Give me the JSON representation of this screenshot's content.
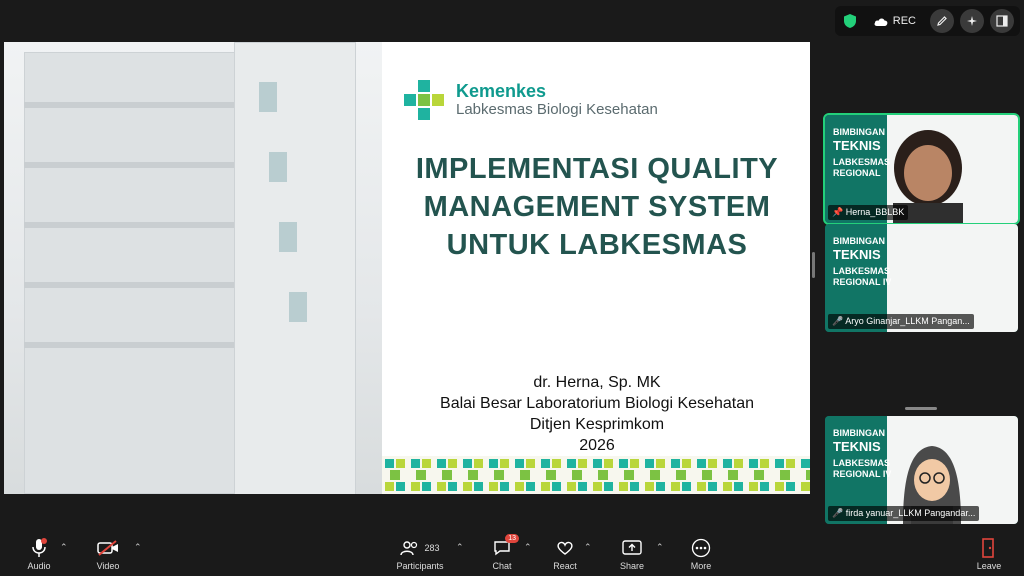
{
  "top": {
    "rec_label": "REC"
  },
  "slide": {
    "logo_name": "Kemenkes",
    "logo_sub": "Labkesmas Biologi Kesehatan",
    "title_lines": [
      "IMPLEMENTASI QUALITY",
      "MANAGEMENT SYSTEM",
      "UNTUK LABKESMAS"
    ],
    "presenter_lines": [
      "dr. Herna, Sp. MK",
      "Balai Besar Laboratorium Biologi Kesehatan",
      "Ditjen Kesprimkom",
      "2026"
    ]
  },
  "tiles": [
    {
      "name": "Herna_BBLBK",
      "label_small": "BIMBINGAN",
      "label_big": "TEKNIS",
      "label_sub1": "LABKESMAS",
      "label_sub2": "REGIONAL"
    },
    {
      "name": "Aryo Ginanjar_LLKM Pangan...",
      "label_small": "BIMBINGAN",
      "label_big": "TEKNIS",
      "label_sub1": "LABKESMAS",
      "label_sub2": "REGIONAL IV"
    },
    {
      "name": "firda yanuar_LLKM Pangandar...",
      "label_small": "BIMBINGAN",
      "label_big": "TEKNIS",
      "label_sub1": "LABKESMAS",
      "label_sub2": "REGIONAL IV"
    }
  ],
  "toolbar": {
    "audio": "Audio",
    "video": "Video",
    "participants": "Participants",
    "participants_count": "283",
    "chat": "Chat",
    "chat_badge": "13",
    "react": "React",
    "share": "Share",
    "more": "More",
    "leave": "Leave"
  },
  "colors": {
    "accent_green": "#23d07a",
    "brand_teal": "#0f9a8e",
    "title_teal": "#23544f",
    "mute_red": "#e0453c"
  }
}
